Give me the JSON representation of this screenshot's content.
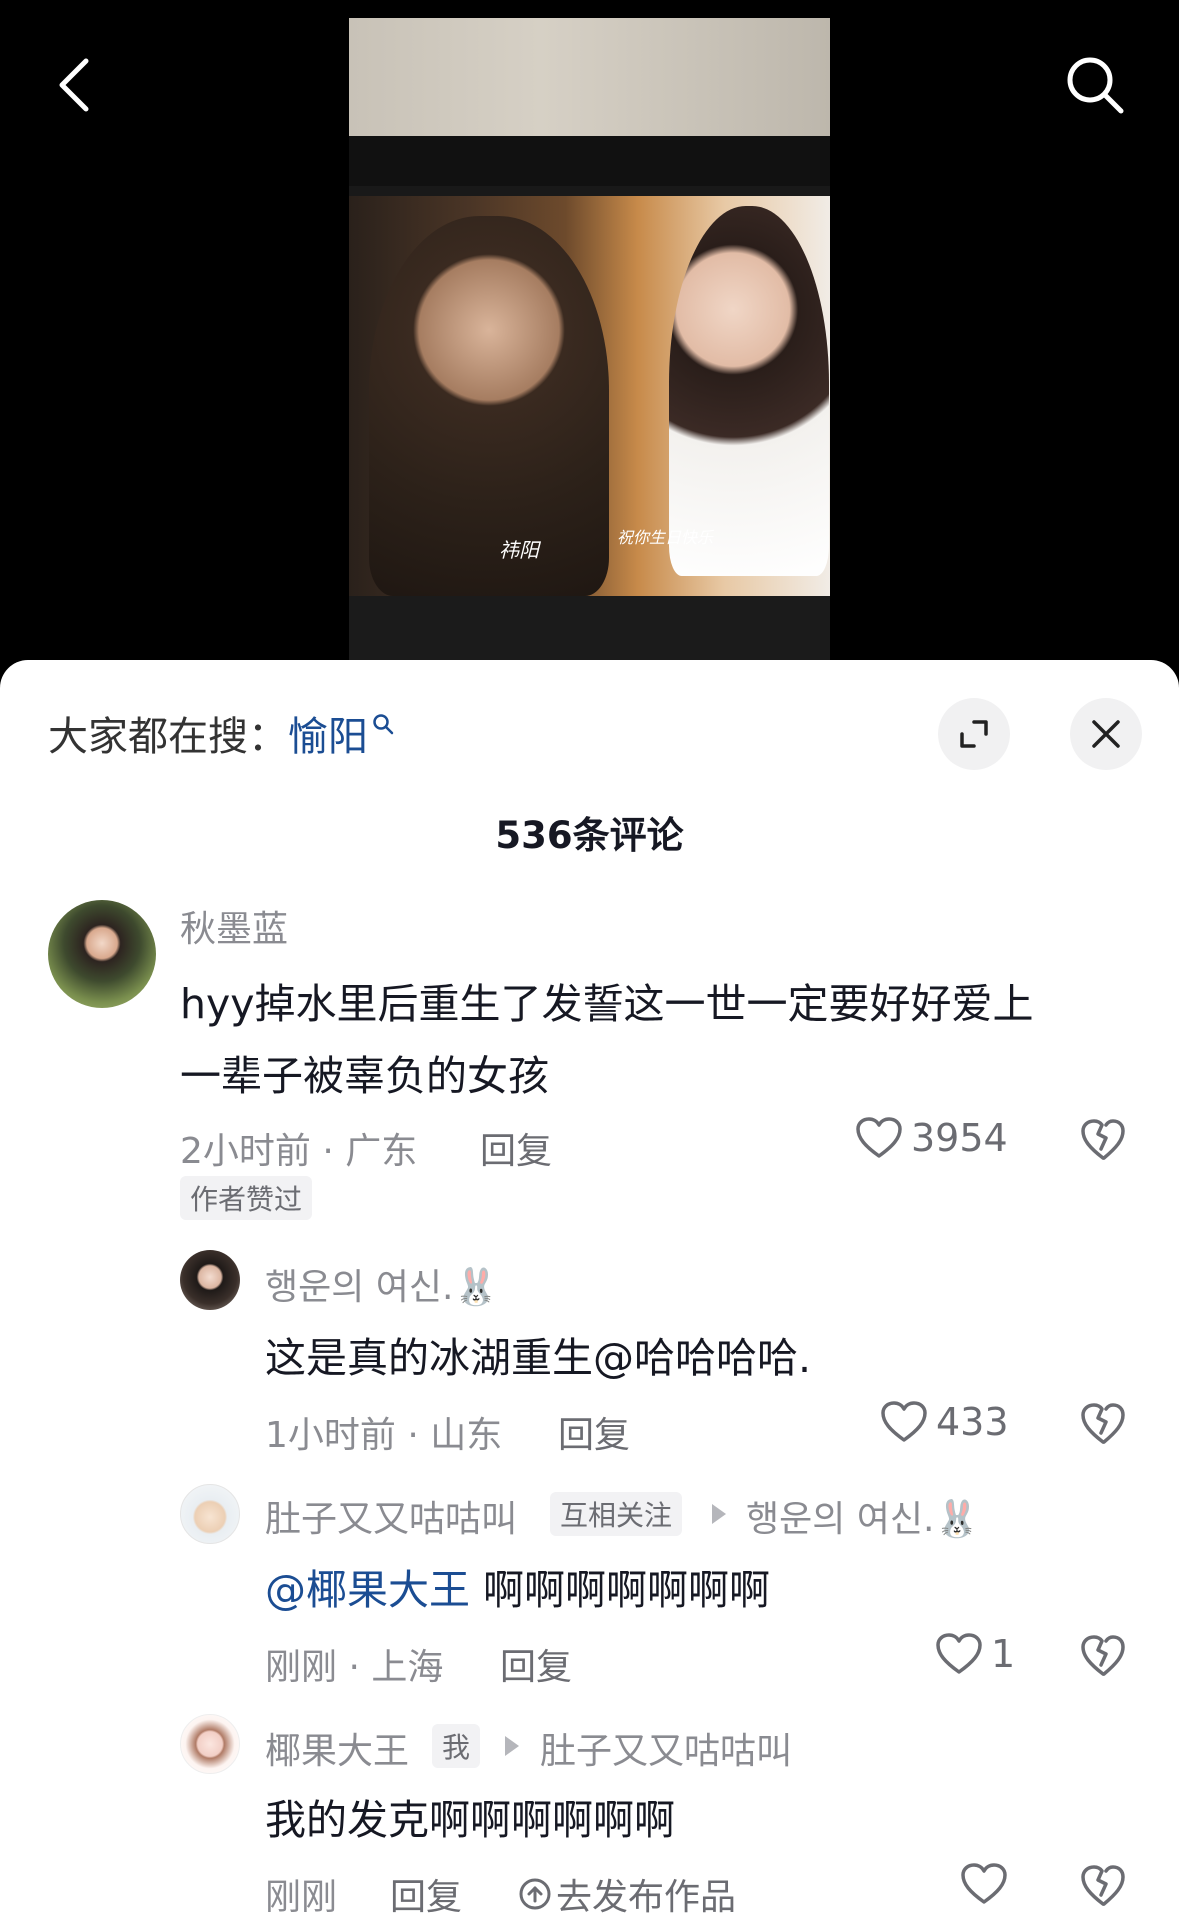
{
  "nav": {
    "back_icon": "chevron-left-icon",
    "search_icon": "search-icon"
  },
  "video": {
    "caption_left": "祎阳",
    "caption_right": "祝你生日快乐"
  },
  "sheet": {
    "search_prefix": "大家都在搜：",
    "search_keyword": "愉阳",
    "expand_icon": "expand-icon",
    "close_icon": "close-icon",
    "comment_count": "536条评论"
  },
  "comments": [
    {
      "name": "秋墨蓝",
      "text_line1": "hyy掉水里后重生了发誓这一世一定要好好爱上",
      "text_line2": "一辈子被辜负的女孩",
      "time": "2小时前 · 广东",
      "reply": "回复",
      "likes": "3954",
      "badge": "作者赞过"
    },
    {
      "name": "행운의 여신.🐰",
      "text": "这是真的冰湖重生@哈哈哈哈.",
      "time": "1小时前 · 山东",
      "reply": "回复",
      "likes": "433"
    },
    {
      "name": "肚子又又咕咕叫",
      "tag": "互相关注",
      "reply_to": "행운의 여신.🐰",
      "mention": "@椰果大王",
      "text": "啊啊啊啊啊啊啊",
      "time": "刚刚 · 上海",
      "reply": "回复",
      "likes": "1"
    },
    {
      "name": "椰果大王",
      "tag": "我",
      "reply_to": "肚子又又咕咕叫",
      "text": "我的发克啊啊啊啊啊啊",
      "time": "刚刚",
      "reply": "回复",
      "publish": "去发布作品",
      "likes": ""
    }
  ],
  "colors": {
    "link_blue": "#1b4d93",
    "meta_gray": "#8a8b91",
    "text_dark": "#161823"
  }
}
